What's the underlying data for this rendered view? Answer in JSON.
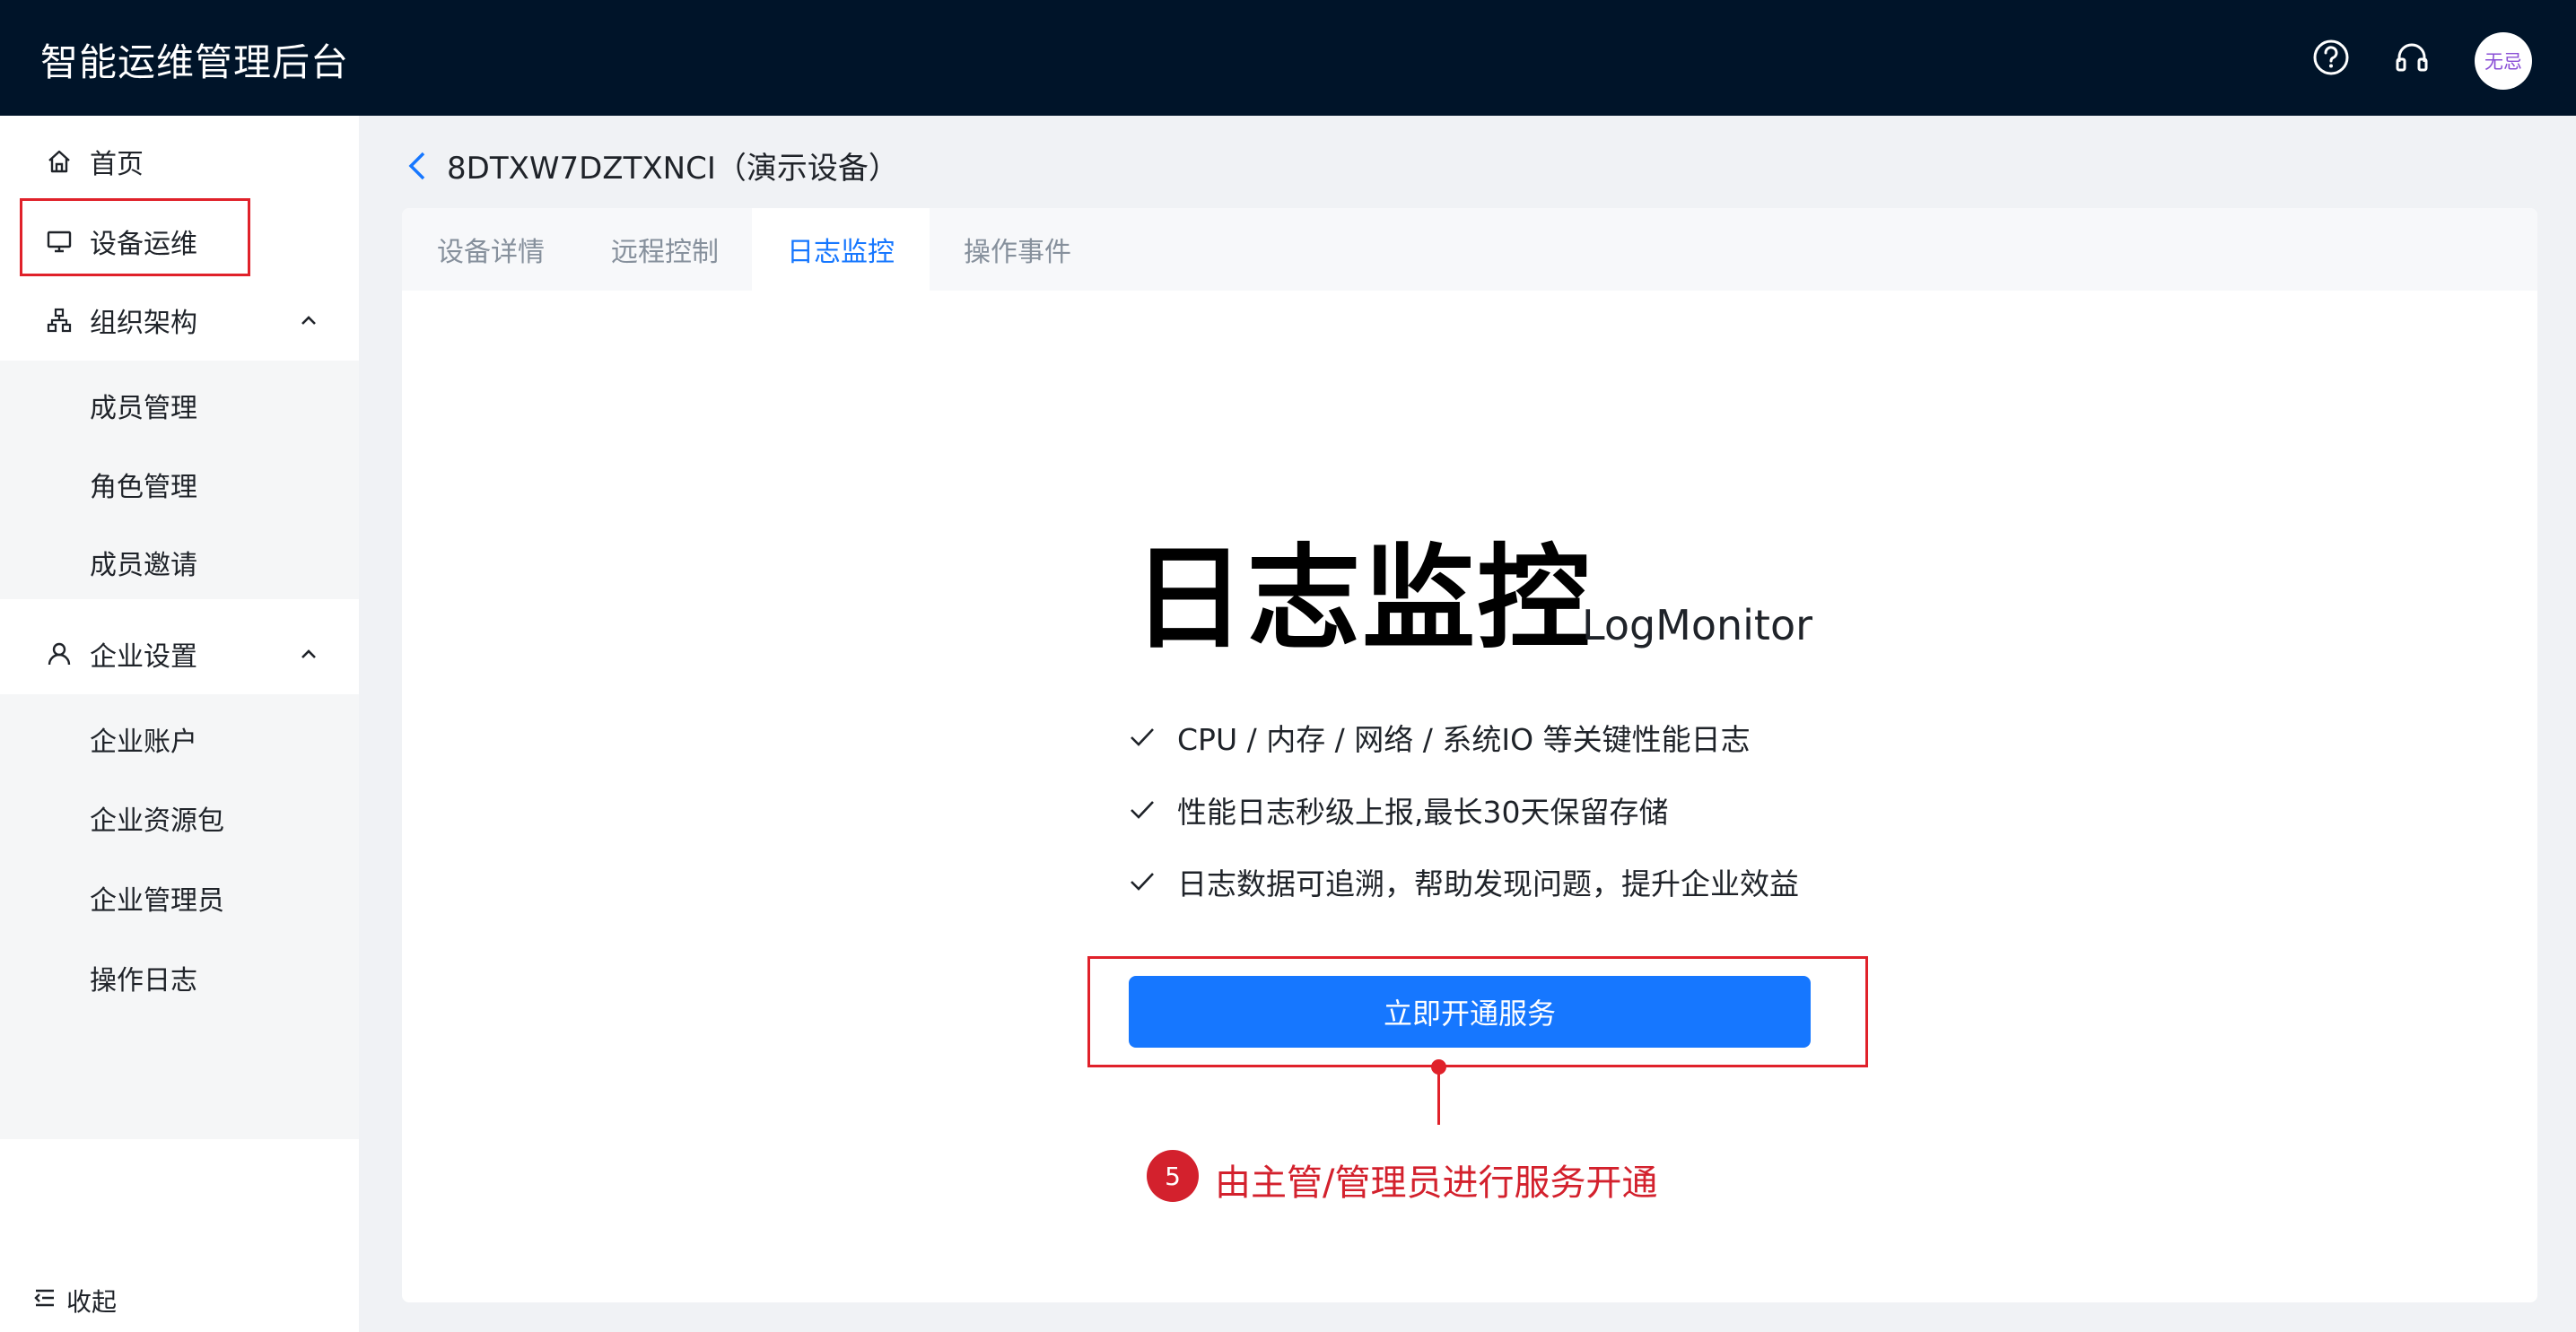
{
  "header": {
    "title": "智能运维管理后台",
    "help_icon": "question-circle-icon",
    "support_icon": "headset-icon",
    "avatar_text": "无忌"
  },
  "sidebar": {
    "items": [
      {
        "label": "首页",
        "icon": "home-icon"
      },
      {
        "label": "设备运维",
        "icon": "monitor-icon"
      },
      {
        "label": "组织架构",
        "icon": "org-chart-icon",
        "expanded": true,
        "children": [
          "成员管理",
          "角色管理",
          "成员邀请"
        ]
      },
      {
        "label": "企业设置",
        "icon": "user-icon",
        "expanded": true,
        "children": [
          "企业账户",
          "企业资源包",
          "企业管理员",
          "操作日志"
        ]
      }
    ],
    "collapse_label": "收起"
  },
  "breadcrumb": {
    "title": "8DTXW7DZTXNCI（演示设备）"
  },
  "tabs": [
    {
      "label": "设备详情"
    },
    {
      "label": "远程控制"
    },
    {
      "label": "日志监控",
      "active": true
    },
    {
      "label": "操作事件"
    }
  ],
  "promo": {
    "title": "日志监控",
    "subtitle": "LogMonitor",
    "features": [
      "CPU / 内存 / 网络 / 系统IO 等关键性能日志",
      "性能日志秒级上报,最长30天保留存储",
      "日志数据可追溯，帮助发现问题，提升企业效益"
    ],
    "cta_label": "立即开通服务"
  },
  "annotation": {
    "step_number": "5",
    "text": "由主管/管理员进行服务开通",
    "color": "#d3212d"
  },
  "colors": {
    "header_bg": "#001429",
    "accent": "#1677ff",
    "annotation_red": "#e0212a"
  }
}
